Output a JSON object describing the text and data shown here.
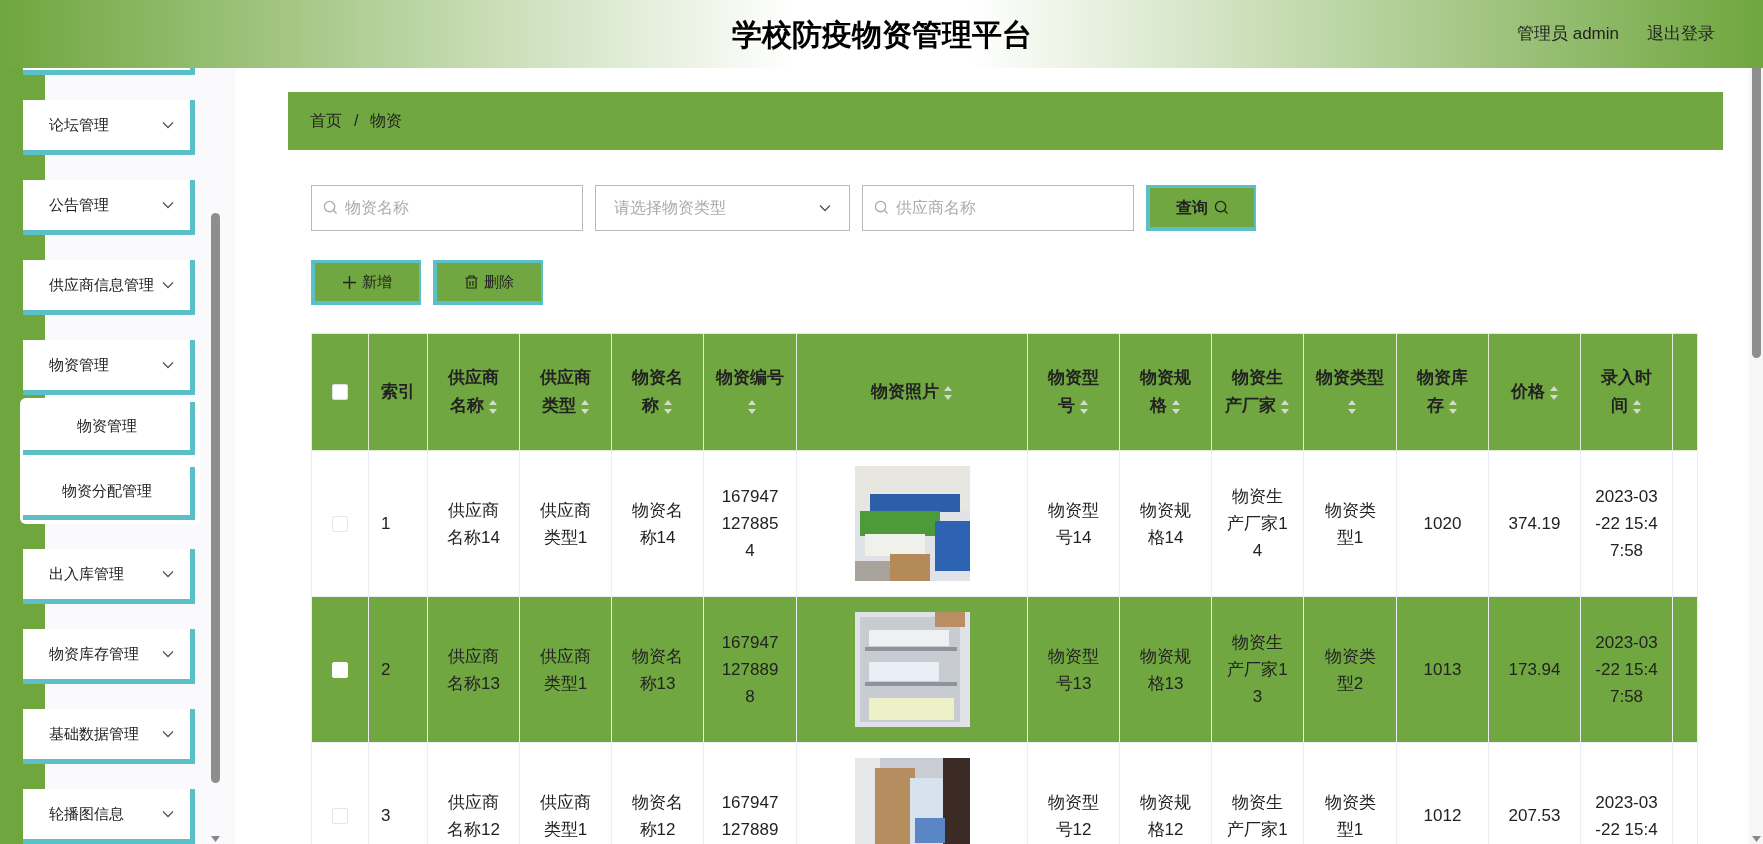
{
  "header": {
    "title": "学校防疫物资管理平台",
    "user": "管理员 admin",
    "logout": "退出登录"
  },
  "sidebar": {
    "items": [
      {
        "label": "论坛管理"
      },
      {
        "label": "公告管理"
      },
      {
        "label": "供应商信息管理"
      },
      {
        "label": "物资管理",
        "children": [
          {
            "label": "物资管理"
          },
          {
            "label": "物资分配管理"
          }
        ]
      },
      {
        "label": "出入库管理"
      },
      {
        "label": "物资库存管理"
      },
      {
        "label": "基础数据管理"
      },
      {
        "label": "轮播图信息"
      }
    ]
  },
  "breadcrumb": {
    "items": [
      "首页",
      "物资"
    ],
    "separator": "/"
  },
  "search": {
    "fields": [
      {
        "kind": "input",
        "placeholder": "物资名称"
      },
      {
        "kind": "select",
        "placeholder": "请选择物资类型"
      },
      {
        "kind": "input",
        "placeholder": "供应商名称"
      }
    ],
    "button": "查询"
  },
  "actions": [
    {
      "kind": "add",
      "label": "新增"
    },
    {
      "kind": "delete",
      "label": "删除"
    }
  ],
  "table": {
    "select_all_checked": false,
    "columns": [
      {
        "label": "索引",
        "sortable": false
      },
      {
        "label": "供应商名称",
        "sortable": true
      },
      {
        "label": "供应商类型",
        "sortable": true
      },
      {
        "label": "物资名称",
        "sortable": true
      },
      {
        "label": "物资编号",
        "sortable": true
      },
      {
        "label": "物资照片",
        "sortable": true
      },
      {
        "label": "物资型号",
        "sortable": true
      },
      {
        "label": "物资规格",
        "sortable": true
      },
      {
        "label": "物资生产厂家",
        "sortable": true
      },
      {
        "label": "物资类型",
        "sortable": true
      },
      {
        "label": "物资库存",
        "sortable": true
      },
      {
        "label": "价格",
        "sortable": true
      },
      {
        "label": "录入时间",
        "sortable": true
      }
    ],
    "rows": [
      {
        "selected": false,
        "checked": false,
        "cells": [
          "1",
          "供应商名称14",
          "供应商类型1",
          "物资名称14",
          "1679471278854",
          {
            "kind": "picture"
          },
          "物资型号14",
          "物资规格14",
          "物资生产厂家14",
          "物资类型1",
          "1020",
          "374.19",
          "2023-03-22 15:47:58"
        ]
      },
      {
        "selected": true,
        "checked": false,
        "cells": [
          "2",
          "供应商名称13",
          "供应商类型1",
          "物资名称13",
          "1679471278898",
          {
            "kind": "picture"
          },
          "物资型号13",
          "物资规格13",
          "物资生产厂家13",
          "物资类型2",
          "1013",
          "173.94",
          "2023-03-22 15:47:58"
        ]
      },
      {
        "selected": false,
        "checked": false,
        "cells": [
          "3",
          "供应商名称12",
          "供应商类型1",
          "物资名称12",
          "167947127889",
          {
            "kind": "picture"
          },
          "物资型号12",
          "物资规格12",
          "物资生产厂家1",
          "物资类型1",
          "1012",
          "207.53",
          "2023-03-22 15:4"
        ]
      }
    ]
  }
}
